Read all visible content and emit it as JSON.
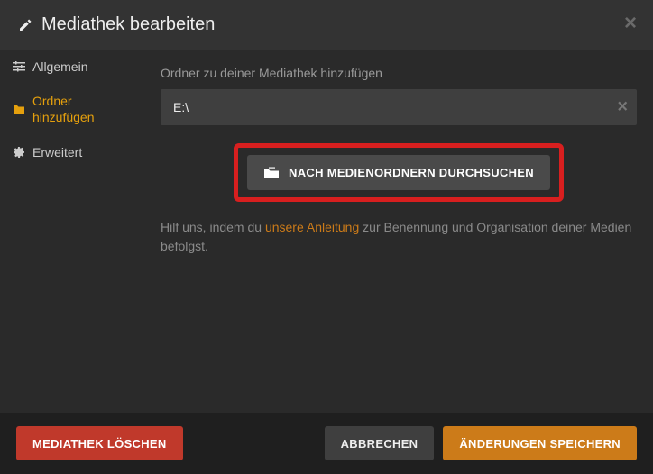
{
  "header": {
    "title": "Mediathek bearbeiten"
  },
  "sidebar": {
    "items": [
      {
        "label": "Allgemein"
      },
      {
        "label": "Ordner hinzufügen"
      },
      {
        "label": "Erweitert"
      }
    ]
  },
  "content": {
    "field_label": "Ordner zu deiner Mediathek hinzufügen",
    "paths": [
      {
        "value": "E:\\"
      }
    ],
    "browse_label": "NACH MEDIENORDNERN DURCHSUCHEN",
    "help_prefix": "Hilf uns, indem du ",
    "help_link": "unsere Anleitung",
    "help_suffix": " zur Benennung und Organisation deiner Medien befolgst."
  },
  "footer": {
    "delete_label": "MEDIATHEK LÖSCHEN",
    "cancel_label": "ABBRECHEN",
    "save_label": "ÄNDERUNGEN SPEICHERN"
  }
}
